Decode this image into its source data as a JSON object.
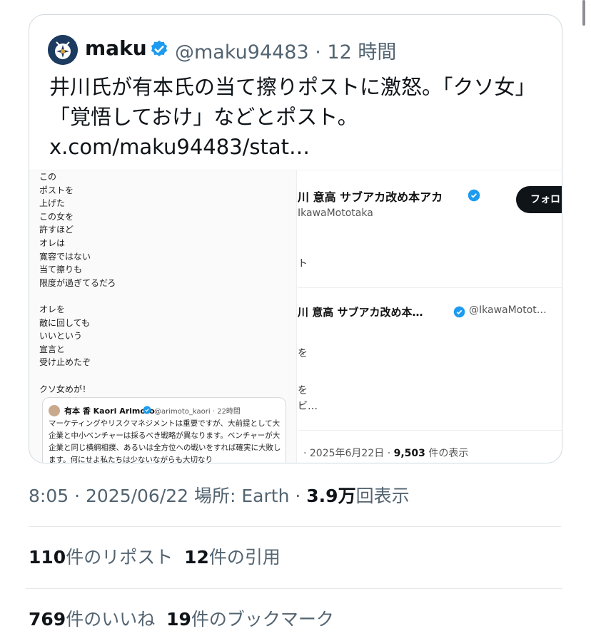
{
  "quoted_post": {
    "author_name": "maku",
    "author_handle_time": "@maku94483 · 12 時間",
    "text": "井川氏が有本氏の当て擦りポストに激怒。「クソ女」「覚悟しておけ」などとポスト。 x.com/maku94483/stat…",
    "left_screenshot": {
      "poem": "この\nポストを\n上げた\nこの女を\n許すほど\nオレは\n寛容ではない\n当て擦りも\n限度が過ぎてるだろ\n\nオレを\n敵に回しても\nいいという\n宣言と\n受け止めたぞ\n\nクソ女めが！",
      "embedded_author": "有本 香 Kaori Arimoto",
      "embedded_handle": "@arimoto_kaori · 22時間",
      "embedded_text": "マーケティングやリスクマネジメントは重要ですが、大前提として大企業と中小ベンチャーは採るべき戦略が異なります。ベンチャーが大企業と同じ横綱相撲、あるいは全方位への戦いをすれば確実に大敗します。何にせよ私たちは少ないながらも大切なり"
    },
    "right_screenshot": {
      "name": "川 意高 サブアカ改め本アカ",
      "handle": "IkawaMototaka",
      "follow_label": "フォロ",
      "frag1": "ト",
      "name2": "川 意高 サブアカ改め本…",
      "handle2": "@IkawaMotot…",
      "frag2": "を",
      "frag3": "を",
      "frag4": "ビ…",
      "meta_prefix": "· 2025年6月22日 · ",
      "views_number": "9,503",
      "views_suffix": " 件の表示"
    }
  },
  "post_meta": {
    "time_date_place": "8:05 · 2025/06/22 場所: Earth · ",
    "views_number": "3.9万",
    "views_label": "回表示"
  },
  "stats": {
    "reposts_number": "110",
    "reposts_label": "件のリポスト",
    "quotes_number": "12",
    "quotes_label": "件の引用",
    "likes_number": "769",
    "likes_label": "件のいいね",
    "bookmarks_number": "19",
    "bookmarks_label": "件のブックマーク"
  },
  "colors": {
    "verified": "#1d9bf0",
    "text_primary": "#0f1419",
    "text_secondary": "#536471"
  }
}
